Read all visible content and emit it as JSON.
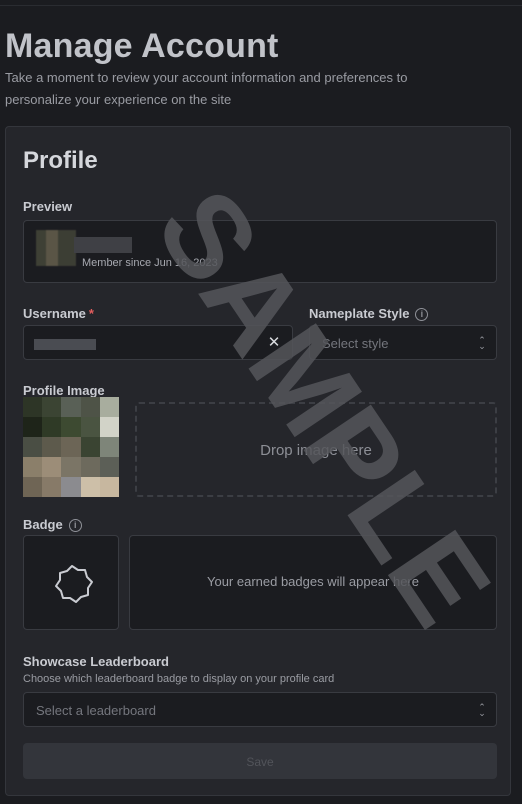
{
  "header": {
    "title": "Manage Account",
    "subtitle": "Take a moment to review your account information and preferences to personalize your experience on the site"
  },
  "profile": {
    "title": "Profile",
    "preview_label": "Preview",
    "member_since": "Member since Jun 16, 2023",
    "username_label": "Username",
    "required_mark": "*",
    "nameplate_label": "Nameplate Style",
    "nameplate_placeholder": "Select style",
    "profile_image_label": "Profile Image",
    "drop_text": "Drop image here",
    "badge_label": "Badge",
    "badges_empty_text": "Your earned badges will appear here",
    "leaderboard_label": "Showcase Leaderboard",
    "leaderboard_help": "Choose which leaderboard badge to display on your profile card",
    "leaderboard_placeholder": "Select a leaderboard",
    "save_label": "Save"
  },
  "icons": {
    "info": "info-icon",
    "clear": "close-icon",
    "select": "chevron-up-down-icon",
    "badge": "badge-outline-icon"
  },
  "watermark": "SAMPLE",
  "colors": {
    "background": "#1b1c20",
    "card": "#25262b",
    "required": "#e35d5d"
  }
}
